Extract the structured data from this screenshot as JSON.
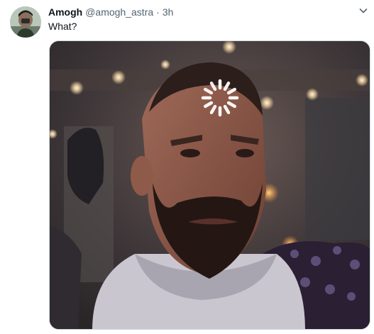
{
  "tweet": {
    "author_name": "Amogh",
    "handle": "@amogh_astra",
    "separator": "·",
    "time": "3h",
    "text": "What?",
    "more_icon": "chevron-down-icon",
    "avatar_icon": "avatar-image",
    "media_icon": "video-frame",
    "loading_icon": "loading-spinner-icon"
  },
  "colors": {
    "name": "#0f1419",
    "secondary_text": "#536471",
    "media_border": "#cfd9de",
    "spinner": "#ffffff"
  }
}
